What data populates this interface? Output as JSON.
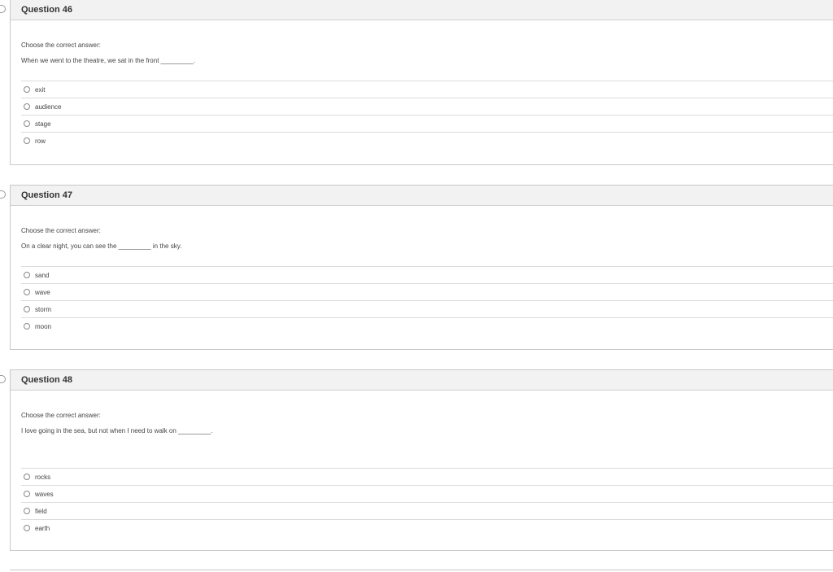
{
  "questions": [
    {
      "title": "Question 46",
      "instruction": "Choose the correct answer:",
      "prompt": "When we went to the theatre, we sat in the front _________.",
      "options": [
        "exit",
        "audience",
        "stage",
        "row"
      ]
    },
    {
      "title": "Question 47",
      "instruction": "Choose the correct answer:",
      "prompt": "On a clear night, you can see the _________ in the sky.",
      "options": [
        "sand",
        "wave",
        "storm",
        "moon"
      ]
    },
    {
      "title": "Question 48",
      "instruction": "Choose the correct answer:",
      "prompt": "I love going in the sea, but not when I need to walk on _________.",
      "options": [
        "rocks",
        "waves",
        "field",
        "earth"
      ]
    }
  ]
}
